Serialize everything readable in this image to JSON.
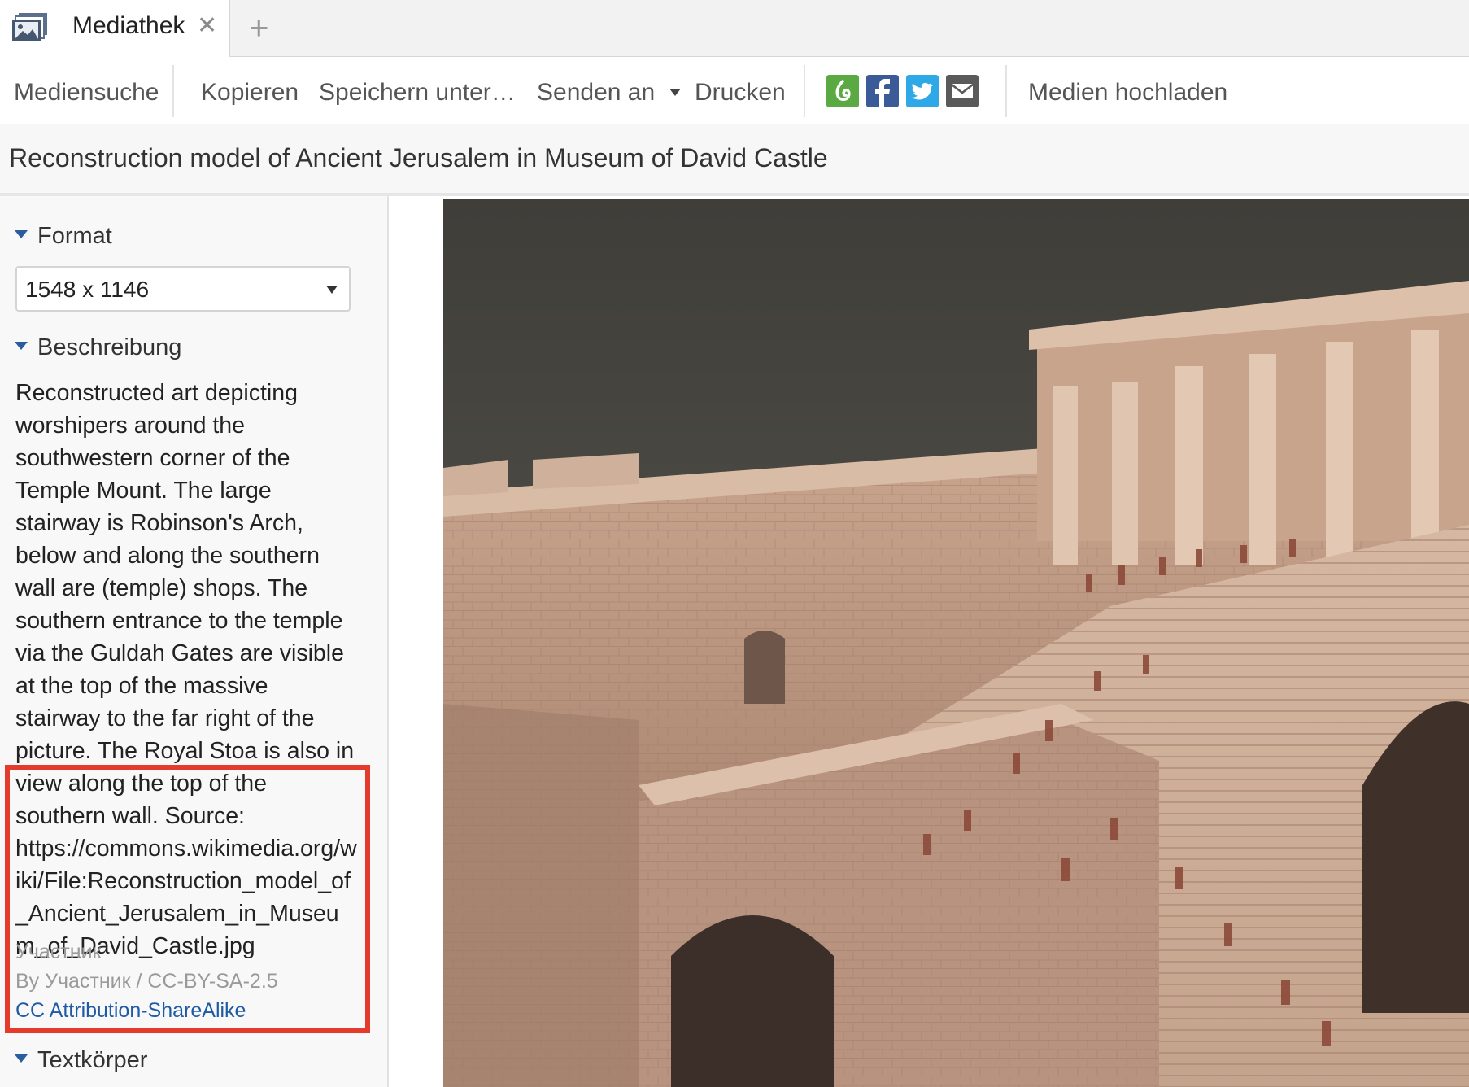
{
  "tabbar": {
    "tab_title": "Mediathek",
    "close_glyph": "✕",
    "new_tab_glyph": "+",
    "tab_icon": "media-library-icon"
  },
  "toolbar": {
    "items": [
      "Mediensuche",
      "Kopieren",
      "Speichern unter…",
      "Senden an",
      "Drucken",
      "Medien hochladen"
    ],
    "share_icons": [
      "evernote-icon",
      "facebook-icon",
      "twitter-icon",
      "mail-icon"
    ],
    "colors": {
      "evernote": "#5aa943",
      "facebook": "#3b5a98",
      "twitter": "#2ea8e6",
      "mail": "#5a5a5a"
    }
  },
  "page": {
    "title": "Reconstruction model of Ancient Jerusalem in Museum of David Castle"
  },
  "sidebar": {
    "format": {
      "heading": "Format",
      "selected": "1548 x 1146"
    },
    "description": {
      "heading": "Beschreibung",
      "text": "Reconstructed art depicting worshipers around the southwestern corner of the Temple Mount. The large stairway is Robinson's Arch, below and along the southern wall are (temple) shops. The southern entrance to the temple via the Guldah Gates are visible at the top of the massive stairway to the far right of the picture. The Royal Stoa is also in view along the top of the southern wall. Source: https://commons.wikimedia.org/wiki/File:Reconstruction_model_of_Ancient_Jerusalem_in_Museum_of_David_Castle.jpg",
      "author": "Участник",
      "credit": "By Участник / CC-BY-SA-2.5",
      "license": "CC Attribution-ShareAlike"
    },
    "body": {
      "heading": "Textkörper"
    }
  },
  "accent": {
    "link": "#1f5aa6",
    "highlight": "#e53b2c",
    "triangle": "#2b5d9e"
  }
}
